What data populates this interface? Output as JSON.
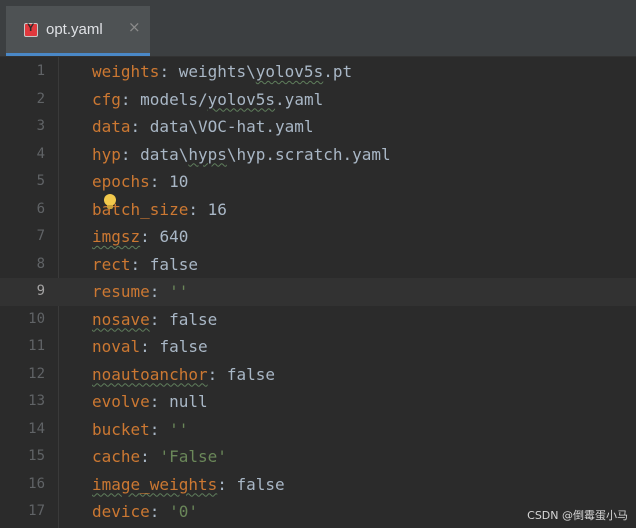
{
  "tab": {
    "label": "opt.yaml",
    "icon": "yaml-file-icon",
    "close_glyph": "×"
  },
  "editor": {
    "current_line": 9,
    "lines": [
      {
        "num": "1",
        "key": "weights",
        "sep": ": ",
        "value": "weights\\yolov5s.pt"
      },
      {
        "num": "2",
        "key": "cfg",
        "sep": ": ",
        "value": "models/yolov5s.yaml"
      },
      {
        "num": "3",
        "key": "data",
        "sep": ": ",
        "value": "data\\VOC-hat.yaml"
      },
      {
        "num": "4",
        "key": "hyp",
        "sep": ": ",
        "value": "data\\hyps\\hyp.scratch.yaml"
      },
      {
        "num": "5",
        "key": "epochs",
        "sep": ": ",
        "value": "10"
      },
      {
        "num": "6",
        "key": "batch_size",
        "sep": ": ",
        "value": "16"
      },
      {
        "num": "7",
        "key": "imgsz",
        "sep": ": ",
        "value": "640"
      },
      {
        "num": "8",
        "key": "rect",
        "sep": ": ",
        "value": "false"
      },
      {
        "num": "9",
        "key": "resume",
        "sep": ": ",
        "value": "''"
      },
      {
        "num": "10",
        "key": "nosave",
        "sep": ": ",
        "value": "false"
      },
      {
        "num": "11",
        "key": "noval",
        "sep": ": ",
        "value": "false"
      },
      {
        "num": "12",
        "key": "noautoanchor",
        "sep": ": ",
        "value": "false"
      },
      {
        "num": "13",
        "key": "evolve",
        "sep": ": ",
        "value": "null"
      },
      {
        "num": "14",
        "key": "bucket",
        "sep": ": ",
        "value": "''"
      },
      {
        "num": "15",
        "key": "cache",
        "sep": ": ",
        "value": "'False'"
      },
      {
        "num": "16",
        "key": "image_weights",
        "sep": ": ",
        "value": "false"
      },
      {
        "num": "17",
        "key": "device",
        "sep": ": ",
        "value": "'0'"
      }
    ]
  },
  "watermark": "CSDN @倒霉蛋小马",
  "colors": {
    "background": "#2b2b2b",
    "key": "#cc7832",
    "value": "#a9b7c6",
    "string": "#6a8759",
    "line_number": "#606366",
    "tab_underline": "#4a88c7"
  }
}
